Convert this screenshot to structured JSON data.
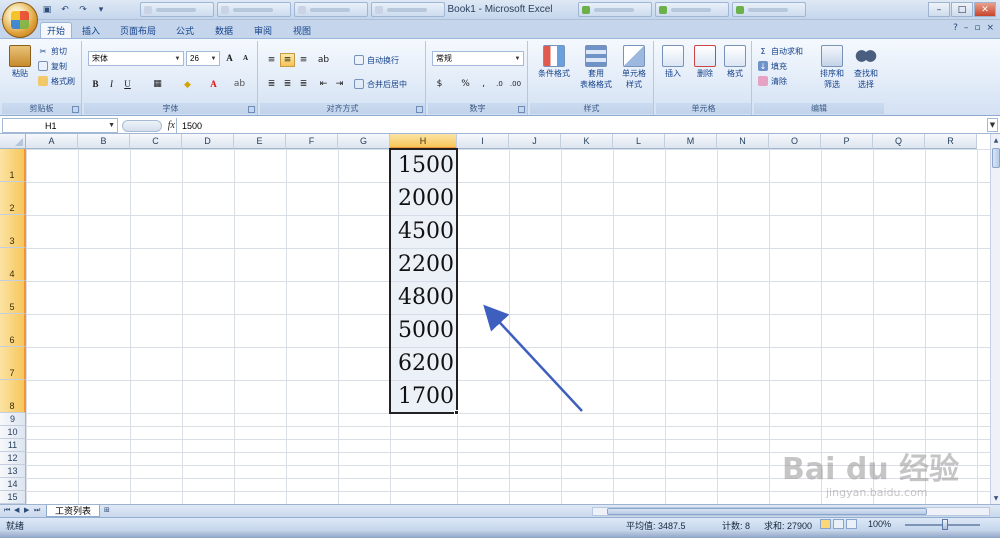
{
  "window": {
    "title": "Book1 - Microsoft Excel",
    "min": "–",
    "max": "□",
    "close": "✕"
  },
  "ribbon_tabs": [
    "开始",
    "插入",
    "页面布局",
    "公式",
    "数据",
    "审阅",
    "视图"
  ],
  "clipboard": {
    "paste": "粘贴",
    "cut": "剪切",
    "copy": "复制",
    "format_painter": "格式刷",
    "label": "剪贴板"
  },
  "font": {
    "name": "宋体",
    "size": "26",
    "bold": "B",
    "italic": "I",
    "underline": "U",
    "label": "字体",
    "grow": "A",
    "shrink": "A",
    "fill": "◆",
    "color": "A"
  },
  "alignment": {
    "wrap": "自动换行",
    "merge": "合并后居中",
    "label": "对齐方式"
  },
  "number": {
    "format": "常规",
    "percent": "%",
    "comma": ",",
    "label": "数字"
  },
  "styles": {
    "conditional": "条件格式",
    "table1": "套用",
    "table2": "表格格式",
    "cell1": "单元格",
    "cell2": "样式",
    "label": "样式"
  },
  "cells": {
    "insert": "插入",
    "delete": "删除",
    "format": "格式",
    "label": "单元格"
  },
  "editing": {
    "autosum": "自动求和",
    "fill": "填充",
    "clear": "清除",
    "sort1": "排序和",
    "sort2": "筛选",
    "find1": "查找和",
    "find2": "选择",
    "label": "编辑"
  },
  "formula_bar": {
    "name_box": "H1",
    "fx": "fx",
    "value": "1500"
  },
  "columns": [
    "A",
    "B",
    "C",
    "D",
    "E",
    "F",
    "G",
    "H",
    "I",
    "J",
    "K",
    "L",
    "M",
    "N",
    "O",
    "P",
    "Q",
    "R"
  ],
  "rows": [
    "1",
    "2",
    "3",
    "4",
    "5",
    "6",
    "7",
    "8",
    "9",
    "10",
    "11",
    "12",
    "13",
    "14",
    "15"
  ],
  "cells_h": [
    "1500",
    "2000",
    "4500",
    "2200",
    "4800",
    "5000",
    "6200",
    "1700"
  ],
  "sheet_tab": "工资列表",
  "status": {
    "ready": "就绪",
    "average": "平均值: 3487.5",
    "count": "计数: 8",
    "sum": "求和: 27900",
    "zoom": "100%"
  },
  "watermark": {
    "brand": "Bai du 经验",
    "url": "jingyan.baidu.com"
  },
  "colors": {
    "accent": "#f29436",
    "arrow": "#3f5fbf",
    "ribbon": "#dbe6f4"
  }
}
